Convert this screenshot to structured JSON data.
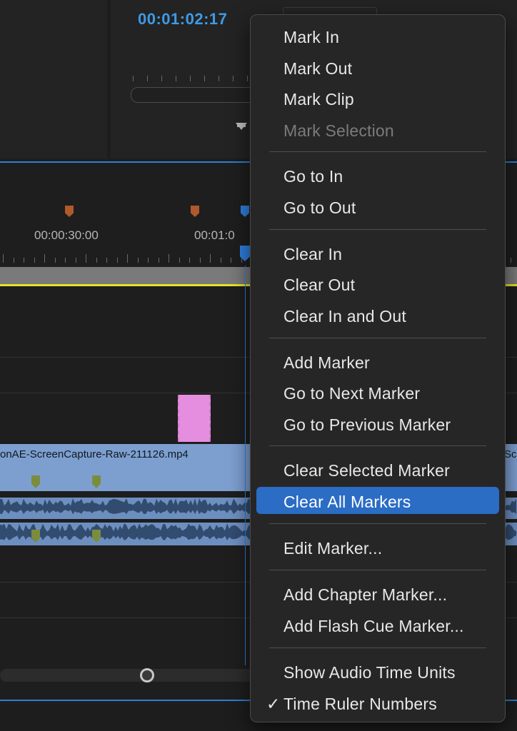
{
  "monitor": {
    "timecode": "00:01:02:17"
  },
  "timeline": {
    "ruler_labels": [
      "00:00:30:00",
      "00:01:0"
    ],
    "clip_name": "onAE-ScreenCapture-Raw-211126.mp4",
    "clip_name_right": "Sc"
  },
  "context_menu": {
    "items": [
      {
        "label": "Mark In",
        "enabled": true
      },
      {
        "label": "Mark Out",
        "enabled": true
      },
      {
        "label": "Mark Clip",
        "enabled": true
      },
      {
        "label": "Mark Selection",
        "enabled": false
      },
      {
        "label": "Go to In",
        "enabled": true
      },
      {
        "label": "Go to Out",
        "enabled": true
      },
      {
        "label": "Clear In",
        "enabled": true
      },
      {
        "label": "Clear Out",
        "enabled": true
      },
      {
        "label": "Clear In and Out",
        "enabled": true
      },
      {
        "label": "Add Marker",
        "enabled": true
      },
      {
        "label": "Go to Next Marker",
        "enabled": true
      },
      {
        "label": "Go to Previous Marker",
        "enabled": true
      },
      {
        "label": "Clear Selected Marker",
        "enabled": true
      },
      {
        "label": "Clear All Markers",
        "enabled": true,
        "highlighted": true
      },
      {
        "label": "Edit Marker...",
        "enabled": true
      },
      {
        "label": "Add Chapter Marker...",
        "enabled": true
      },
      {
        "label": "Add Flash Cue Marker...",
        "enabled": true
      },
      {
        "label": "Show Audio Time Units",
        "enabled": true
      },
      {
        "label": "Time Ruler Numbers",
        "enabled": true,
        "checked": true
      }
    ],
    "check_glyph": "✓"
  },
  "colors": {
    "accent_blue": "#2f7fe0",
    "highlight": "#2b6cc4",
    "timecode": "#3f9ae6",
    "work_area_line": "#e6e22f",
    "video_clip": "#7d9fd0",
    "pink_clip": "#e58ee0"
  }
}
